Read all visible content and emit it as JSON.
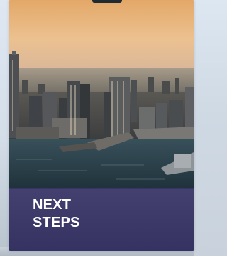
{
  "card": {
    "title_lines": [
      "NEXT",
      "STEPS"
    ],
    "image": "city-skyline-harbor-aerial",
    "overlay_color": "#3a3668",
    "text_color": "#ffffff"
  }
}
